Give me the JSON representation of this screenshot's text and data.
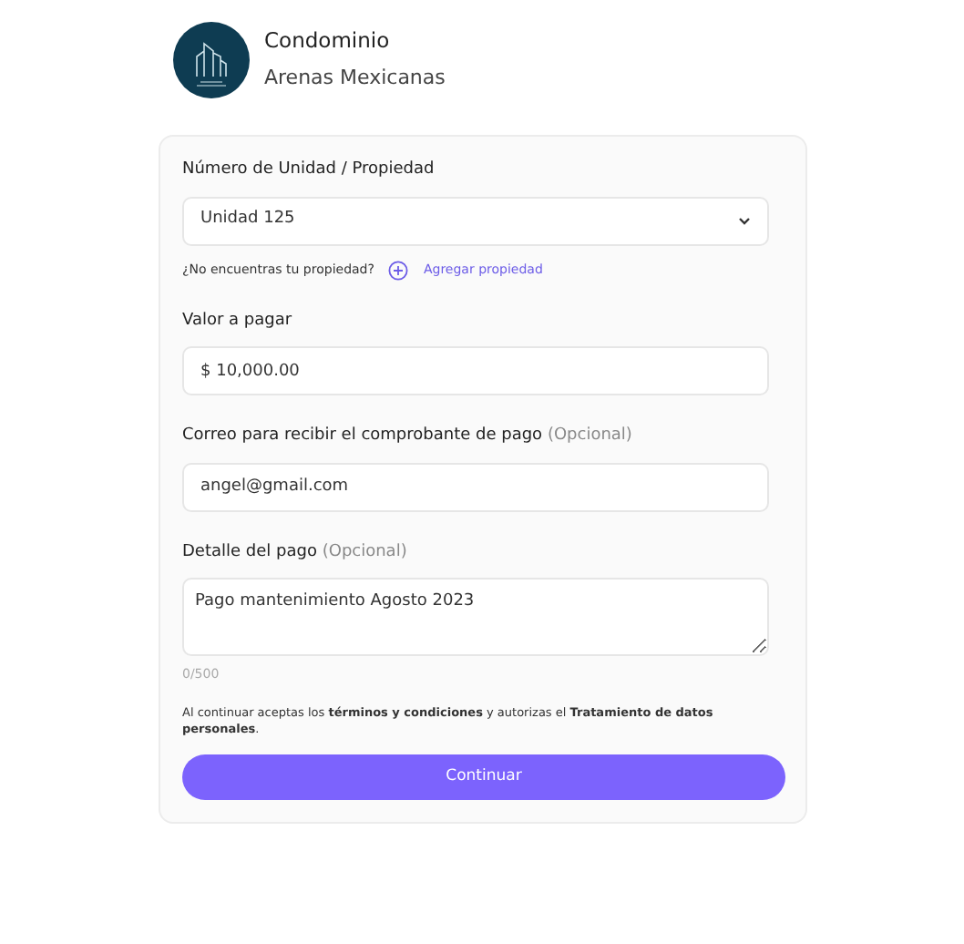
{
  "header": {
    "title": "Condominio",
    "subtitle": "Arenas Mexicanas"
  },
  "form": {
    "fields": [
      {
        "kind": "select",
        "label": "Número de Unidad / Propiedad",
        "value": "Unidad 125",
        "help": "¿No encuentras tu propiedad?",
        "link": "Agregar propiedad"
      },
      {
        "kind": "input",
        "label": "Valor a pagar",
        "value": "$ 10,000.00"
      },
      {
        "kind": "input",
        "label": "Correo para recibir el comprobante de pago",
        "optional": "(Opcional)",
        "value": "angel@gmail.com"
      },
      {
        "kind": "textarea",
        "label": "Detalle del pago",
        "optional": "(Opcional)",
        "value": "Pago mantenimiento Agosto 2023",
        "counter": "0/500"
      }
    ],
    "legal": "Al continuar aceptas los **términos y condiciones** y autorizas el **Tratamiento de datos personales**.",
    "button": "Continuar"
  }
}
